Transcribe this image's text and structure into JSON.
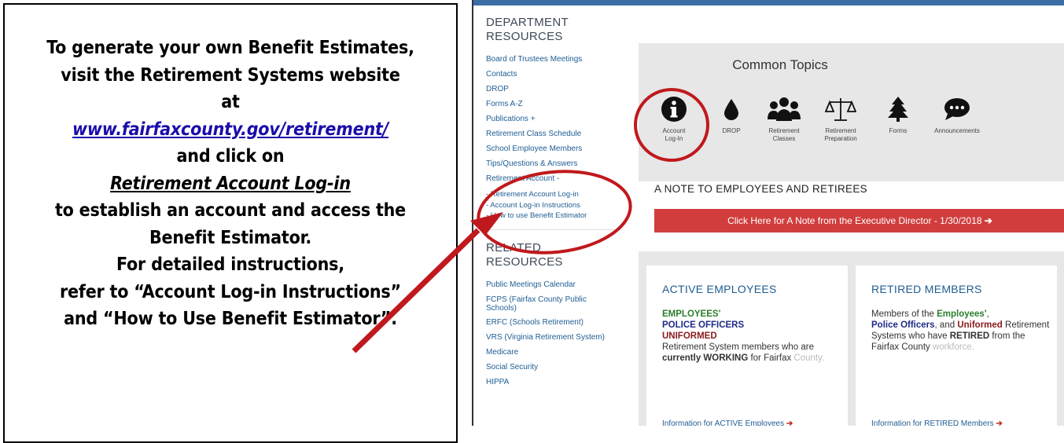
{
  "callout": {
    "line1": "To generate your own Benefit Estimates,",
    "line2": "visit the Retirement Systems website",
    "line3": "at",
    "link": "www.fairfaxcounty.gov/retirement/",
    "line5": "and click on",
    "emph": "Retirement Account Log-in",
    "line7": "to establish an account and access the",
    "line8": "Benefit Estimator.",
    "line9": "For detailed instructions,",
    "line10": "refer to “Account Log-in Instructions”",
    "line11": "and “How to Use Benefit Estimator”."
  },
  "sidebar": {
    "dept_heading_1": "DEPARTMENT",
    "dept_heading_2": "RESOURCES",
    "dept_links": [
      "Board of Trustees Meetings",
      "Contacts",
      "DROP",
      "Forms A-Z",
      "Publications  +",
      "Retirement Class Schedule",
      "School Employee Members",
      "Tips/Questions & Answers",
      "Retirement Account  -"
    ],
    "sub_links": [
      "-  Retirement Account Log-in",
      "-  Account Log-in Instructions",
      "-  How to use Benefit Estimator"
    ],
    "related_heading_1": "RELATED",
    "related_heading_2": "RESOURCES",
    "related_links": [
      "Public Meetings Calendar",
      "FCPS (Fairfax County Public Schools)",
      "ERFC (Schools Retirement)",
      "VRS (Virginia Retirement System)",
      "Medicare",
      "Social Security",
      "HIPPA"
    ]
  },
  "topics": {
    "title": "Common Topics",
    "items": [
      {
        "label": "Account\nLog-In",
        "icon": "info-icon"
      },
      {
        "label": "DROP",
        "icon": "drop-icon"
      },
      {
        "label": "Retirement\nClasses",
        "icon": "group-icon"
      },
      {
        "label": "Retirement\nPreparation",
        "icon": "scale-icon"
      },
      {
        "label": "Forms",
        "icon": "tree-icon"
      },
      {
        "label": "Announcements",
        "icon": "chat-icon"
      }
    ]
  },
  "note": {
    "title": "A NOTE TO EMPLOYEES AND RETIREES",
    "button": "Click Here for A Note from the Executive Director - 1/30/2018"
  },
  "cards": {
    "active": {
      "title": "ACTIVE EMPLOYEES",
      "l1": "EMPLOYEES'",
      "l2": "POLICE OFFICERS",
      "l3": "UNIFORMED",
      "body_a": "Retirement System members who are ",
      "body_b": "currently WORKING",
      "body_c": " for Fairfax ",
      "body_fade": "County.",
      "link": "Information for ACTIVE Employees"
    },
    "retired": {
      "title": "RETIRED MEMBERS",
      "a": "Members of the ",
      "b": "Employees'",
      "c": ",",
      "d": "Police Officers",
      "e": ", and ",
      "f": "Uniformed",
      "g": " Retirement Systems who have ",
      "h": "RETIRED",
      "i": " from the Fairfax County ",
      "fade": "workforce.",
      "link": "Information for RETIRED Members"
    }
  },
  "colors": {
    "accent_red": "#c0281f",
    "link_blue": "#1f5d93",
    "button_red": "#d13d3d"
  }
}
